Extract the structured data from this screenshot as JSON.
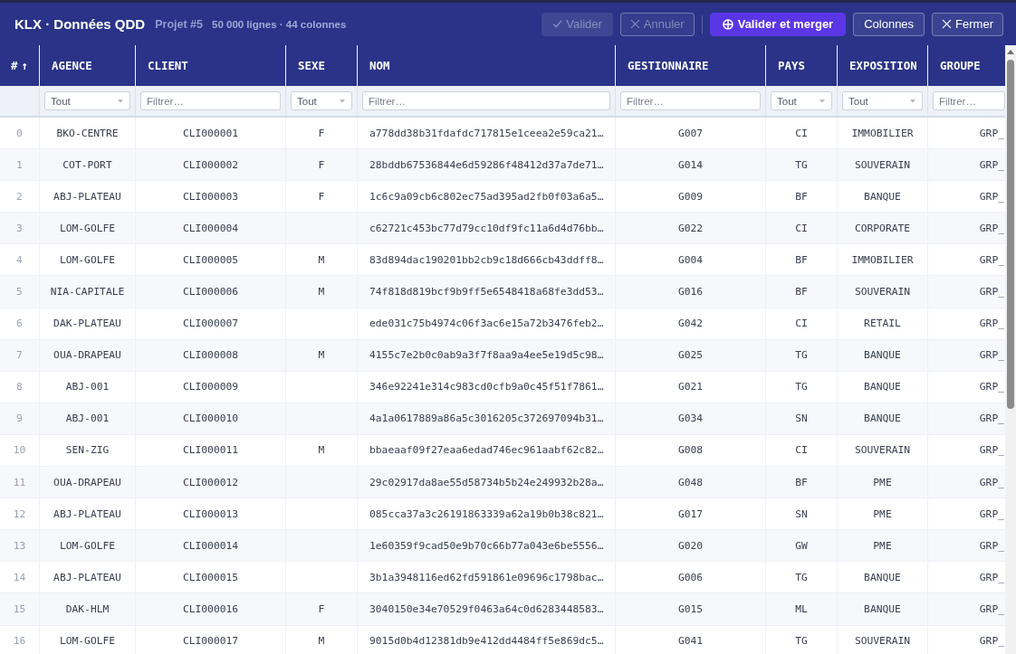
{
  "header": {
    "title": "KLX · Données QDD",
    "project": "Projet #5",
    "stats": "50 000 lignes · 44 colonnes",
    "button_groups": [
      [
        {
          "label": "Valider",
          "kind": "confirm",
          "disabled": true
        },
        {
          "label": "Annuler",
          "kind": "cancel",
          "disabled": true
        }
      ],
      [
        {
          "label": "Valider et merger",
          "kind": "merge",
          "disabled": false
        },
        {
          "label": "Colonnes",
          "kind": "plain",
          "disabled": false
        },
        {
          "label": "Fermer",
          "kind": "close",
          "disabled": false
        }
      ]
    ]
  },
  "table": {
    "columns": [
      {
        "label": "#",
        "sort_arrow": "↑"
      },
      {
        "label": "AGENCE",
        "filter": {
          "kind": "select",
          "value": "Tout"
        }
      },
      {
        "label": "CLIENT",
        "filter": {
          "kind": "text",
          "placeholder": "Filtrer…"
        }
      },
      {
        "label": "SEXE",
        "filter": {
          "kind": "select",
          "value": "Tout"
        }
      },
      {
        "label": "NOM",
        "filter": {
          "kind": "text",
          "placeholder": "Filtrer…"
        }
      },
      {
        "label": "GESTIONNAIRE",
        "filter": {
          "kind": "text",
          "placeholder": "Filtrer…"
        }
      },
      {
        "label": "PAYS",
        "filter": {
          "kind": "select",
          "value": "Tout"
        }
      },
      {
        "label": "EXPOSITION",
        "filter": {
          "kind": "select",
          "value": "Tout"
        }
      },
      {
        "label": "GROUPE",
        "filter": {
          "kind": "text",
          "placeholder": "Filtrer…"
        }
      }
    ],
    "rows": [
      {
        "index": "0",
        "agence": "BKO-CENTRE",
        "client": "CLI000001",
        "sexe": "F",
        "nom": "a778dd38b31fdafdc717815e1ceea2e59ca21…",
        "gestionnaire": "G007",
        "pays": "CI",
        "exposition": "IMMOBILIER",
        "groupe": "GRP_"
      },
      {
        "index": "1",
        "agence": "COT-PORT",
        "client": "CLI000002",
        "sexe": "F",
        "nom": "28bddb67536844e6d59286f48412d37a7de71…",
        "gestionnaire": "G014",
        "pays": "TG",
        "exposition": "SOUVERAIN",
        "groupe": "GRP_"
      },
      {
        "index": "2",
        "agence": "ABJ-PLATEAU",
        "client": "CLI000003",
        "sexe": "F",
        "nom": "1c6c9a09cb6c802ec75ad395ad2fb0f03a6a5…",
        "gestionnaire": "G009",
        "pays": "BF",
        "exposition": "BANQUE",
        "groupe": "GRP_"
      },
      {
        "index": "3",
        "agence": "LOM-GOLFE",
        "client": "CLI000004",
        "nom": "c62721c453bc77d79cc10df9fc11a6d4d76bb…",
        "gestionnaire": "G022",
        "pays": "CI",
        "exposition": "CORPORATE",
        "groupe": "GRP_"
      },
      {
        "index": "4",
        "agence": "LOM-GOLFE",
        "client": "CLI000005",
        "sexe": "M",
        "nom": "83d894dac190201bb2cb9c18d666cb43ddff8…",
        "gestionnaire": "G004",
        "pays": "BF",
        "exposition": "IMMOBILIER",
        "groupe": "GRP_"
      },
      {
        "index": "5",
        "agence": "NIA-CAPITALE",
        "client": "CLI000006",
        "sexe": "M",
        "nom": "74f818d819bcf9b9ff5e6548418a68fe3dd53…",
        "gestionnaire": "G016",
        "pays": "BF",
        "exposition": "SOUVERAIN",
        "groupe": "GRP_"
      },
      {
        "index": "6",
        "agence": "DAK-PLATEAU",
        "client": "CLI000007",
        "nom": "ede031c75b4974c06f3ac6e15a72b3476feb2…",
        "gestionnaire": "G042",
        "pays": "CI",
        "exposition": "RETAIL",
        "groupe": "GRP_"
      },
      {
        "index": "7",
        "agence": "OUA-DRAPEAU",
        "client": "CLI000008",
        "sexe": "M",
        "nom": "4155c7e2b0c0ab9a3f7f8aa9a4ee5e19d5c98…",
        "gestionnaire": "G025",
        "pays": "TG",
        "exposition": "BANQUE",
        "groupe": "GRP_"
      },
      {
        "index": "8",
        "agence": "ABJ-001",
        "client": "CLI000009",
        "nom": "346e92241e314c983cd0cfb9a0c45f51f7861…",
        "gestionnaire": "G021",
        "pays": "TG",
        "exposition": "BANQUE",
        "groupe": "GRP_"
      },
      {
        "index": "9",
        "agence": "ABJ-001",
        "client": "CLI000010",
        "nom": "4a1a0617889a86a5c3016205c372697094b31…",
        "gestionnaire": "G034",
        "pays": "SN",
        "exposition": "BANQUE",
        "groupe": "GRP_"
      },
      {
        "index": "10",
        "agence": "SEN-ZIG",
        "client": "CLI000011",
        "sexe": "M",
        "nom": "bbaeaaf09f27eaa6edad746ec961aabf62c82…",
        "gestionnaire": "G008",
        "pays": "CI",
        "exposition": "SOUVERAIN",
        "groupe": "GRP_"
      },
      {
        "index": "11",
        "agence": "OUA-DRAPEAU",
        "client": "CLI000012",
        "nom": "29c02917da8ae55d58734b5b24e249932b28a…",
        "gestionnaire": "G048",
        "pays": "BF",
        "exposition": "PME",
        "groupe": "GRP_"
      },
      {
        "index": "12",
        "agence": "ABJ-PLATEAU",
        "client": "CLI000013",
        "nom": "085cca37a3c26191863339a62a19b0b38c821…",
        "gestionnaire": "G017",
        "pays": "SN",
        "exposition": "PME",
        "groupe": "GRP_"
      },
      {
        "index": "13",
        "agence": "LOM-GOLFE",
        "client": "CLI000014",
        "nom": "1e60359f9cad50e9b70c66b77a043e6be5556…",
        "gestionnaire": "G020",
        "pays": "GW",
        "exposition": "PME",
        "groupe": "GRP_"
      },
      {
        "index": "14",
        "agence": "ABJ-PLATEAU",
        "client": "CLI000015",
        "nom": "3b1a3948116ed62fd591861e09696c1798bac…",
        "gestionnaire": "G006",
        "pays": "TG",
        "exposition": "BANQUE",
        "groupe": "GRP_"
      },
      {
        "index": "15",
        "agence": "DAK-HLM",
        "client": "CLI000016",
        "sexe": "F",
        "nom": "3040150e34e70529f0463a64c0d6283448583…",
        "gestionnaire": "G015",
        "pays": "ML",
        "exposition": "BANQUE",
        "groupe": "GRP_"
      },
      {
        "index": "16",
        "agence": "LOM-GOLFE",
        "client": "CLI000017",
        "sexe": "M",
        "nom": "9015d0b4d12381db9e412dd4484ff5e869dc5…",
        "gestionnaire": "G041",
        "pays": "TG",
        "exposition": "SOUVERAIN",
        "groupe": "GRP_"
      }
    ]
  }
}
